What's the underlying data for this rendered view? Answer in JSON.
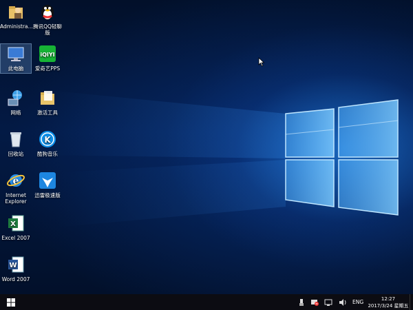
{
  "desktop": {
    "icons": [
      {
        "label": "Administra...",
        "icon": "user-folder-icon"
      },
      {
        "label": "腾讯QQ轻聊版",
        "icon": "qq-penguin-icon"
      },
      {
        "label": "此电脑",
        "icon": "computer-icon"
      },
      {
        "label": "爱奇艺PPS",
        "icon": "iqiyi-icon"
      },
      {
        "label": "网络",
        "icon": "network-icon"
      },
      {
        "label": "激活工具",
        "icon": "folder-icon"
      },
      {
        "label": "回收站",
        "icon": "recycle-bin-icon"
      },
      {
        "label": "酷狗音乐",
        "icon": "kugou-icon"
      },
      {
        "label": "Internet Explorer",
        "icon": "ie-icon"
      },
      {
        "label": "迅雷极速版",
        "icon": "xunlei-icon"
      },
      {
        "label": "Excel 2007",
        "icon": "excel-icon"
      },
      {
        "label": "Word 2007",
        "icon": "word-icon"
      }
    ]
  },
  "taskbar": {
    "language": "ENG",
    "time": "12:27",
    "date": "2017/3/24 星期五",
    "tray_icons": [
      "usb-icon",
      "flag-icon",
      "network-icon",
      "volume-icon"
    ]
  },
  "colors": {
    "accent": "#2a8cff",
    "taskbar": "#0c0c12"
  }
}
